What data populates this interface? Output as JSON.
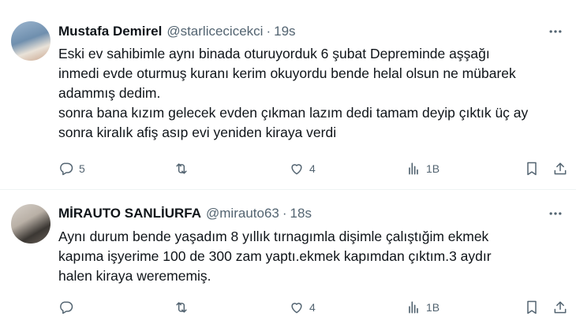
{
  "tweets": [
    {
      "author_name": "Mustafa Demirel",
      "handle": "@starlicecicekci",
      "separator": "·",
      "time": "19s",
      "text_lines": [
        "Eski ev sahibimle aynı binada oturuyorduk 6 şubat Depreminde  aşşağı",
        "inmedi evde oturmuş kuranı kerim okuyordu bende helal olsun ne mübarek",
        "adammış dedim.",
        "sonra bana kızım gelecek evden çıkman lazım dedi tamam deyip çıktık üç ay",
        "sonra kiralık afiş asıp evi yeniden kiraya verdi"
      ],
      "reply_count": "5",
      "retweet_count": "",
      "like_count": "4",
      "view_count": "1B"
    },
    {
      "author_name": "MİRAUTO SANLİURFA",
      "handle": "@mirauto63",
      "separator": "·",
      "time": "18s",
      "text_lines": [
        "Aynı durum  bende yaşadım 8 yıllık tırnagımla dişimle çalıştığim ekmek",
        "kapıma işyerime 100 de 300 zam yaptı.ekmek kapımdan çıktım.3 aydır",
        "halen kiraya werememiş."
      ],
      "reply_count": "",
      "retweet_count": "",
      "like_count": "4",
      "view_count": "1B"
    }
  ],
  "icons": [
    "more-icon",
    "reply-icon",
    "retweet-icon",
    "like-icon",
    "views-icon",
    "bookmark-icon",
    "share-icon"
  ],
  "colors": {
    "text": "#0f1419",
    "secondary": "#536471",
    "divider": "#eff3f4"
  }
}
